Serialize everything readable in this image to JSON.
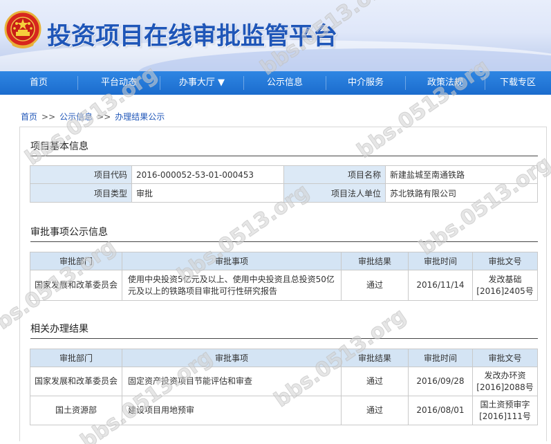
{
  "header": {
    "title": "投资项目在线审批监管平台"
  },
  "nav": {
    "items": [
      "首页",
      "平台动态",
      "办事大厅 ▼",
      "公示信息",
      "中介服务",
      "政策法规",
      "下载专区"
    ]
  },
  "breadcrumb": {
    "home": "首页",
    "sep": ">>",
    "level1": "公示信息",
    "level2": "办理结果公示"
  },
  "project_info": {
    "title": "项目基本信息",
    "code_label": "项目代码",
    "code_value": "2016-000052-53-01-000453",
    "name_label": "项目名称",
    "name_value": "新建盐城至南通铁路",
    "type_label": "项目类型",
    "type_value": "审批",
    "owner_label": "项目法人单位",
    "owner_value": "苏北铁路有限公司"
  },
  "approval_public": {
    "title": "审批事项公示信息",
    "headers": [
      "审批部门",
      "审批事项",
      "审批结果",
      "审批时间",
      "审批文号"
    ],
    "rows": [
      {
        "dept": "国家发展和改革委员会",
        "item": "使用中央投资5亿元及以上、使用中央投资且总投资50亿元及以上的铁路项目审批可行性研究报告",
        "result": "通过",
        "date": "2016/11/14",
        "doc": "发改基础[2016]2405号"
      }
    ]
  },
  "related_results": {
    "title": "相关办理结果",
    "headers": [
      "审批部门",
      "审批事项",
      "审批结果",
      "审批时间",
      "审批文号"
    ],
    "rows": [
      {
        "dept": "国家发展和改革委员会",
        "item": "固定资产投资项目节能评估和审查",
        "result": "通过",
        "date": "2016/09/28",
        "doc": "发改办环资[2016]2088号"
      },
      {
        "dept": "国土资源部",
        "item": "建设项目用地预审",
        "result": "通过",
        "date": "2016/08/01",
        "doc": "国土资预审字[2016]111号"
      }
    ]
  },
  "watermark": {
    "text": "bbs.0513.org"
  },
  "colors": {
    "nav": "#1b6ccd",
    "title": "#1f56b8",
    "table_header": "#d4e4f4",
    "label_cell": "#dce9f6"
  }
}
